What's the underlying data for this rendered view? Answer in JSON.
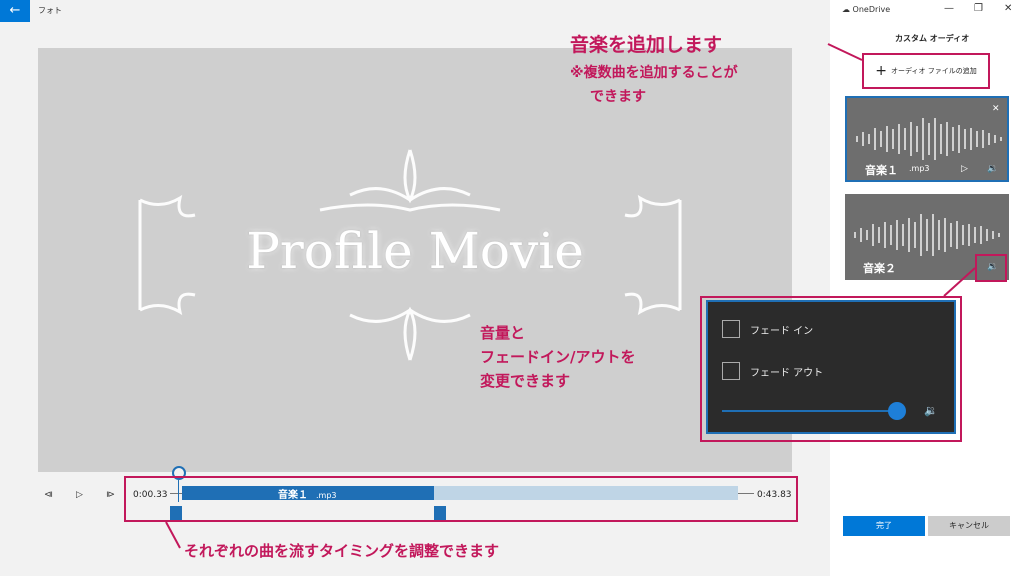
{
  "app": {
    "title": "フォト",
    "onedrive_label": "OneDrive"
  },
  "window_controls": {
    "minimize": "—",
    "maximize": "❐",
    "close": "✕"
  },
  "preview": {
    "title": "Profile Movie"
  },
  "playback": {
    "start_time": "0:00.33",
    "end_time": "0:43.83",
    "progress": 0.0
  },
  "timeline": {
    "clip_name": "音楽１",
    "clip_ext": ".mp3"
  },
  "panel": {
    "title": "カスタム オーディオ",
    "add_audio_label": "オーディオ ファイルの追加",
    "tracks": [
      {
        "name": "音楽１",
        "ext": ".mp3"
      },
      {
        "name": "音楽２",
        "ext": ""
      }
    ],
    "ok_label": "完了",
    "cancel_label": "キャンセル"
  },
  "popup": {
    "fade_in_label": "フェード イン",
    "fade_out_label": "フェード アウト",
    "fade_in_checked": false,
    "fade_out_checked": false,
    "volume": 1.0
  },
  "annotations": {
    "add_music_title": "音楽を追加します",
    "add_music_note_1": "※複数曲を追加することが",
    "add_music_note_2": "できます",
    "volume_line_1": "音量と",
    "volume_line_2": "フェードイン/アウトを",
    "volume_line_3": "変更できます",
    "timing_note": "それぞれの曲を流すタイミングを調整できます"
  },
  "colors": {
    "accent": "#0078d7",
    "annotation": "#c2185b",
    "clip": "#1f6fb5"
  }
}
